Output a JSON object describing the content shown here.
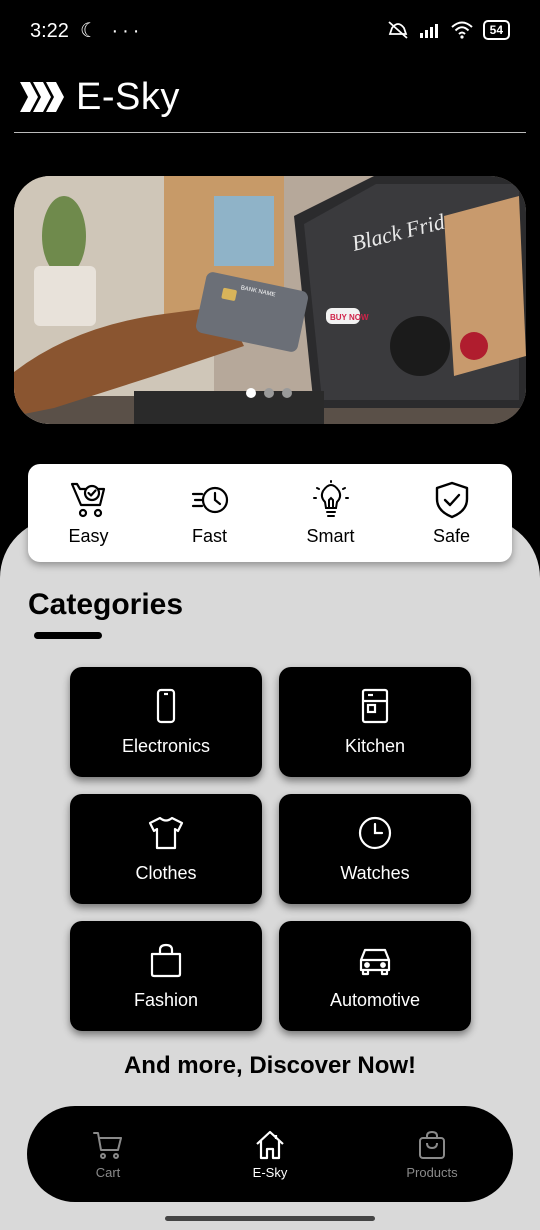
{
  "status_bar": {
    "time": "3:22",
    "left_icons": "☾ ···",
    "battery": "54"
  },
  "header": {
    "title": "E-Sky"
  },
  "banner": {
    "card_text": "BANK NAME",
    "promo_title": "Black Friday",
    "promo_button": "BUY NOW",
    "slides": 3,
    "active_slide": 1
  },
  "features": [
    {
      "label": "Easy",
      "icon": "cart-check-icon"
    },
    {
      "label": "Fast",
      "icon": "fast-clock-icon"
    },
    {
      "label": "Smart",
      "icon": "lightbulb-icon"
    },
    {
      "label": "Safe",
      "icon": "shield-check-icon"
    }
  ],
  "categories": {
    "title": "Categories",
    "items": [
      {
        "label": "Electronics",
        "icon": "phone-icon"
      },
      {
        "label": "Kitchen",
        "icon": "fridge-icon"
      },
      {
        "label": "Clothes",
        "icon": "shirt-icon"
      },
      {
        "label": "Watches",
        "icon": "clock-icon"
      },
      {
        "label": "Fashion",
        "icon": "bag-icon"
      },
      {
        "label": "Automotive",
        "icon": "car-icon"
      }
    ]
  },
  "discover": "And more, Discover Now!",
  "nav": {
    "items": [
      {
        "label": "Cart",
        "icon": "cart-icon"
      },
      {
        "label": "E-Sky",
        "icon": "home-icon"
      },
      {
        "label": "Products",
        "icon": "shopping-bag-icon"
      }
    ],
    "active": "E-Sky"
  },
  "colors": {
    "background": "#000000",
    "content": "#d9d9d9",
    "card": "#ffffff",
    "nav_inactive": "#8a8a8a"
  }
}
